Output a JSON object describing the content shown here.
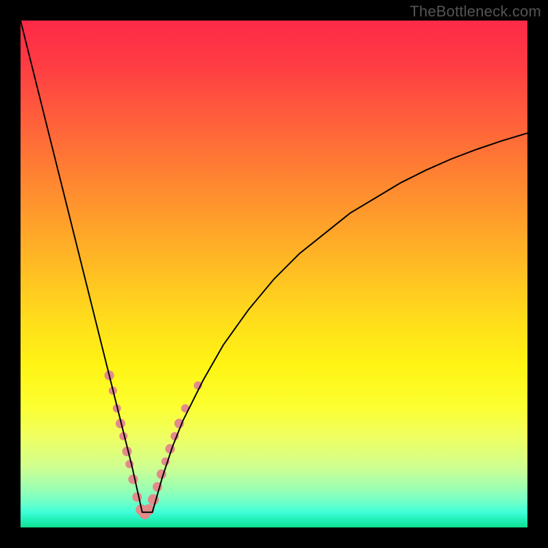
{
  "watermark": "TheBottleneck.com",
  "colors": {
    "gradient_top": "#fe2a47",
    "gradient_bottom": "#10e090",
    "curve": "#000000",
    "markers": "#e38a8a",
    "frame_bg": "#000000"
  },
  "chart_data": {
    "type": "line",
    "title": "",
    "xlabel": "",
    "ylabel": "",
    "xlim": [
      0,
      100
    ],
    "ylim": [
      0,
      100
    ],
    "notes": "V-shaped bottleneck curve; minimum near x≈24. y plotted as 100 - value so higher is worse (red) and 0 is bottom (green).",
    "series": [
      {
        "name": "bottleneck-curve",
        "x": [
          0,
          2,
          4,
          6,
          8,
          10,
          12,
          14,
          16,
          18,
          20,
          22,
          24,
          26,
          28,
          30,
          32,
          36,
          40,
          45,
          50,
          55,
          60,
          65,
          70,
          75,
          80,
          85,
          90,
          95,
          100
        ],
        "y": [
          100,
          92,
          84,
          76,
          68,
          60,
          52,
          44,
          36,
          28,
          20,
          12,
          3,
          3,
          10,
          16,
          21,
          29,
          36,
          43,
          49,
          54,
          58,
          62,
          65,
          68,
          70.5,
          72.7,
          74.6,
          76.3,
          77.8
        ]
      }
    ],
    "markers": [
      {
        "x": 17.5,
        "y": 30,
        "r": 7
      },
      {
        "x": 18.2,
        "y": 27,
        "r": 6
      },
      {
        "x": 19.0,
        "y": 23.5,
        "r": 6
      },
      {
        "x": 19.7,
        "y": 20.5,
        "r": 7
      },
      {
        "x": 20.3,
        "y": 18,
        "r": 6
      },
      {
        "x": 21.0,
        "y": 15,
        "r": 7
      },
      {
        "x": 21.5,
        "y": 12.5,
        "r": 6
      },
      {
        "x": 22.2,
        "y": 9.5,
        "r": 7
      },
      {
        "x": 23.0,
        "y": 6,
        "r": 7
      },
      {
        "x": 23.8,
        "y": 3.5,
        "r": 8
      },
      {
        "x": 24.5,
        "y": 2.7,
        "r": 8
      },
      {
        "x": 25.3,
        "y": 3.5,
        "r": 8
      },
      {
        "x": 26.2,
        "y": 5.5,
        "r": 8
      },
      {
        "x": 27.0,
        "y": 8,
        "r": 7
      },
      {
        "x": 27.8,
        "y": 10.5,
        "r": 7
      },
      {
        "x": 28.6,
        "y": 13,
        "r": 6
      },
      {
        "x": 29.5,
        "y": 15.5,
        "r": 7
      },
      {
        "x": 30.4,
        "y": 18,
        "r": 6
      },
      {
        "x": 31.3,
        "y": 20.5,
        "r": 7
      },
      {
        "x": 32.5,
        "y": 23.5,
        "r": 6
      },
      {
        "x": 35.0,
        "y": 28,
        "r": 6
      }
    ]
  }
}
